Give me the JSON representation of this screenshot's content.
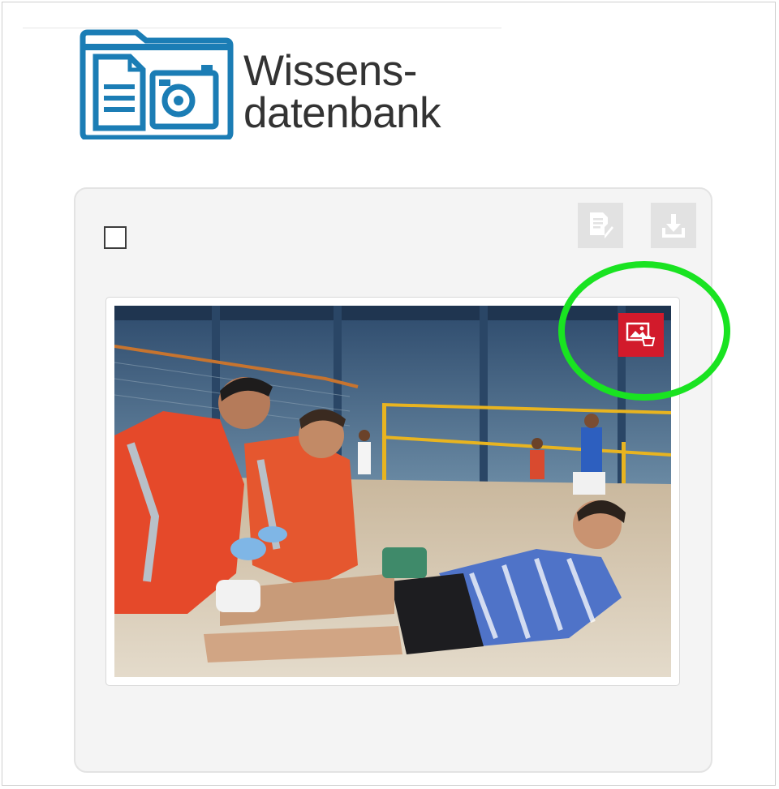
{
  "logo": {
    "title_line1": "Wissens-",
    "title_line2": "datenbank",
    "icon": "folder-document-camera-icon",
    "color": "#1b7db5"
  },
  "card": {
    "checkbox": {
      "checked": false
    },
    "toolbar": {
      "edit_icon": "edit-document-icon",
      "download_icon": "download-icon"
    },
    "thumbnail": {
      "badge_icon": "image-cart-icon",
      "badge_color": "#d21a2b"
    }
  },
  "annotation": {
    "highlight_color": "#19e321"
  }
}
